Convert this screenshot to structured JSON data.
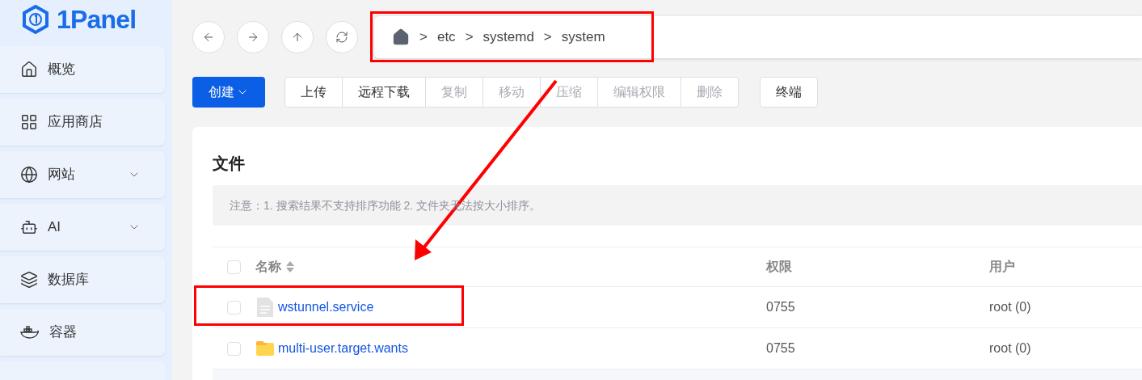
{
  "logo": {
    "text": "1Panel"
  },
  "sidebar": {
    "items": [
      {
        "label": "概览",
        "expandable": false
      },
      {
        "label": "应用商店",
        "expandable": false
      },
      {
        "label": "网站",
        "expandable": true
      },
      {
        "label": "AI",
        "expandable": true
      },
      {
        "label": "数据库",
        "expandable": false
      },
      {
        "label": "容器",
        "expandable": false
      }
    ]
  },
  "breadcrumb": [
    "etc",
    "systemd",
    "system"
  ],
  "breadcrumb_separator": ">",
  "toolbar": {
    "create": "创建",
    "groups": [
      [
        {
          "label": "上传",
          "disabled": false
        },
        {
          "label": "远程下载",
          "disabled": false
        },
        {
          "label": "复制",
          "disabled": true
        },
        {
          "label": "移动",
          "disabled": true
        },
        {
          "label": "压缩",
          "disabled": true
        },
        {
          "label": "编辑权限",
          "disabled": true
        },
        {
          "label": "删除",
          "disabled": true
        }
      ],
      [
        {
          "label": "终端",
          "disabled": false
        }
      ]
    ]
  },
  "panel": {
    "title": "文件",
    "notice": "注意：1. 搜索结果不支持排序功能 2. 文件夹无法按大小排序。"
  },
  "table": {
    "all_checked": false,
    "columns": [
      "名称",
      "权限",
      "用户"
    ],
    "rows": [
      {
        "kind": "file",
        "checked": false,
        "name": "wstunnel.service",
        "permission": "0755",
        "user": "root (0)"
      },
      {
        "kind": "folder",
        "checked": false,
        "name": "multi-user.target.wants",
        "permission": "0755",
        "user": "root (0)"
      }
    ]
  }
}
